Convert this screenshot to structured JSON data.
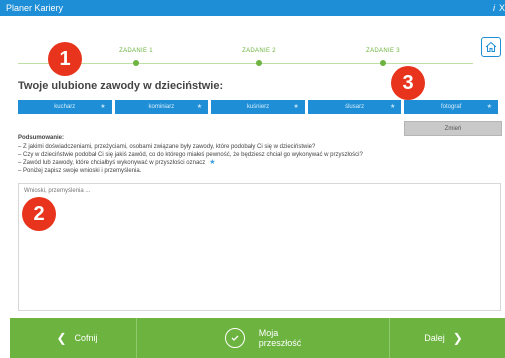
{
  "app": {
    "title": "Planer Kariery",
    "help": "i",
    "close": "X"
  },
  "progress": {
    "steps": [
      "ZADANIE 1",
      "ZADANIE 2",
      "ZADANIE 3"
    ]
  },
  "heading": "Twoje ulubione zawody w dzieciństwie:",
  "professions": [
    {
      "label": "kucharz"
    },
    {
      "label": "kominiarz"
    },
    {
      "label": "kuśnierz"
    },
    {
      "label": "ślusarz"
    },
    {
      "label": "fotograf"
    }
  ],
  "change_label": "Zmień",
  "summary": {
    "title": "Podsumowanie:",
    "lines": [
      "– Z jakimi doświadczeniami, przeżyciami, osobami związane były zawody, które podobały Ci się w dzieciństwie?",
      "– Czy w dzieciństwie podobał Ci się jakiś zawód, co do którego miałeś pewność, że będziesz chciał go wykonywać w przyszłości?",
      "– Zawód lub zawody, które chciałbyś wykonywać w przyszłości oznacz",
      "– Poniżej zapisz swoje wnioski i przemyślenia."
    ]
  },
  "notes": {
    "placeholder": "Wnioski, przemyślenia ...",
    "value": ""
  },
  "badges": [
    "1",
    "2",
    "3"
  ],
  "footer": {
    "prev": "Cofnij",
    "middle_line1": "Moja",
    "middle_line2": "przeszłość",
    "next": "Dalej"
  },
  "colors": {
    "primary_blue": "#1e8fd6",
    "green": "#6cb33f",
    "badge_red": "#e8341c",
    "change_button": "#c9c9c9"
  }
}
